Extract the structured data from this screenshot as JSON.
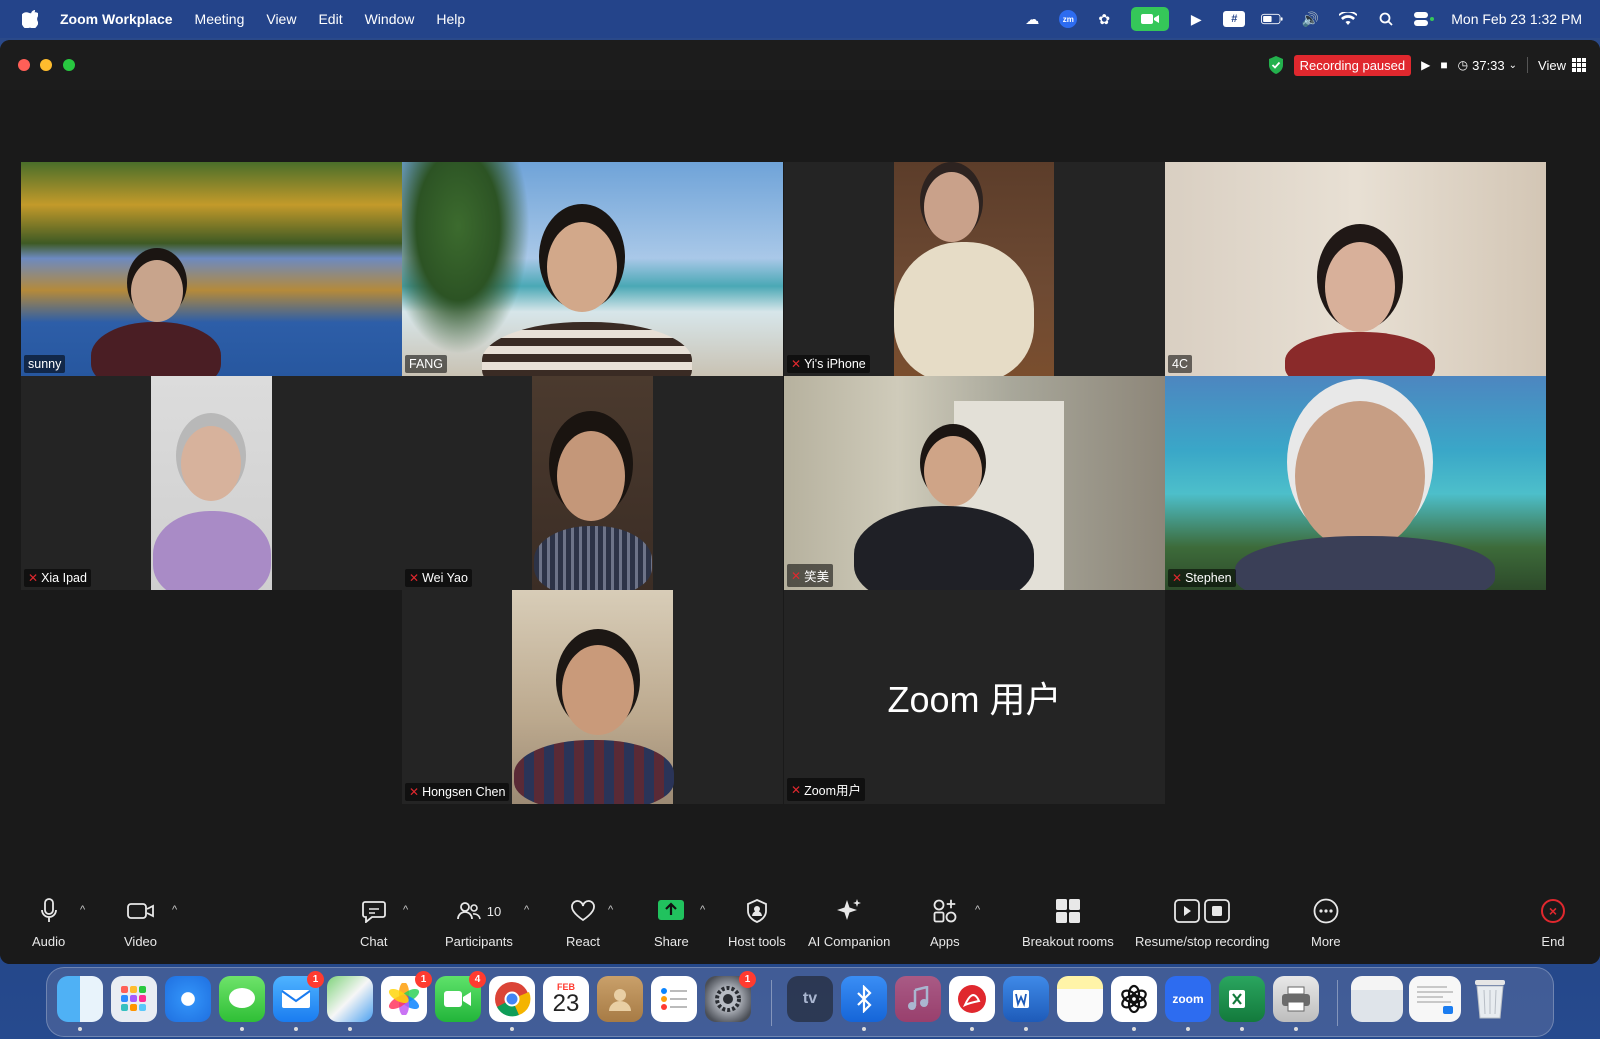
{
  "menubar": {
    "app": "Zoom Workplace",
    "items": [
      "Meeting",
      "View",
      "Edit",
      "Window",
      "Help"
    ],
    "zm_label": "zm",
    "grid_label": "#",
    "clock": "Mon Feb 23  1:32 PM"
  },
  "titlebar": {
    "recording": "Recording paused",
    "timer": "37:33",
    "view": "View"
  },
  "tiles": {
    "sunny": "sunny",
    "fang": "FANG",
    "yi": "Yi's iPhone",
    "c4": "4C",
    "xia": "Xia Ipad",
    "weiyao": "Wei Yao",
    "xiaomei": "笑美",
    "stephen": "Stephen",
    "hongsen": "Hongsen Chen",
    "zoomuser": "Zoom用户",
    "zoomuser_avatar": "Zoom 用户"
  },
  "toolbar": {
    "audio": "Audio",
    "video": "Video",
    "chat": "Chat",
    "participants": "Participants",
    "participants_count": "10",
    "react": "React",
    "share": "Share",
    "host_tools": "Host tools",
    "ai_companion": "AI Companion",
    "apps": "Apps",
    "breakout": "Breakout rooms",
    "resume_stop": "Resume/stop recording",
    "more": "More",
    "end": "End"
  },
  "dock": {
    "mail_badge": "1",
    "photos_badge": "1",
    "facetime_badge": "4",
    "settings_badge": "1",
    "calendar_month": "FEB",
    "calendar_day": "23",
    "zoom_label": "zoom",
    "tv_label": "tv"
  }
}
